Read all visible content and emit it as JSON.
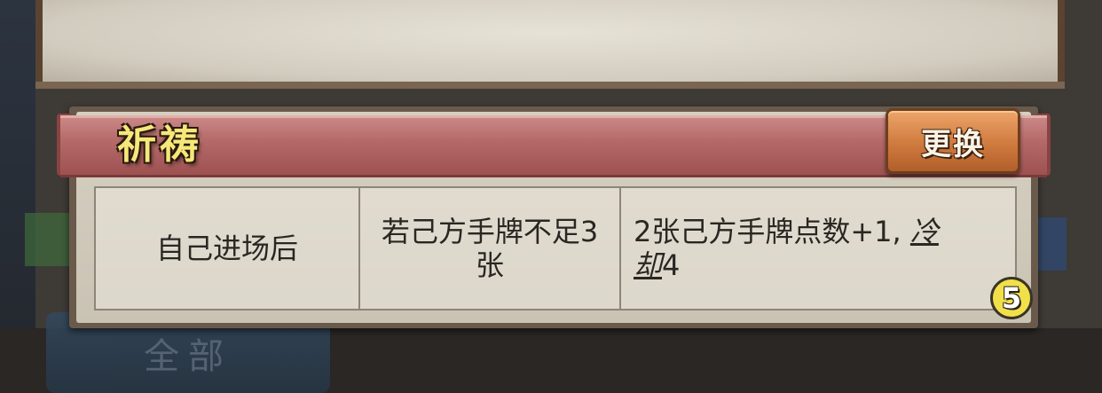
{
  "skill": {
    "name": "祈祷",
    "change_label": "更换",
    "level": "5"
  },
  "effect_table": {
    "cells": [
      "自己进场后",
      "若己方手牌不足3张",
      {
        "text": "2张己方手牌点数+1,",
        "mark1": "冷",
        "mark2": "却",
        "tail": "4"
      }
    ]
  },
  "background": {
    "bottom_button_label": "全部"
  },
  "colors": {
    "banner": "#b56a69",
    "title_text": "#f6e77a",
    "button": "#cf7a3e",
    "badge": "#f2e04a"
  }
}
